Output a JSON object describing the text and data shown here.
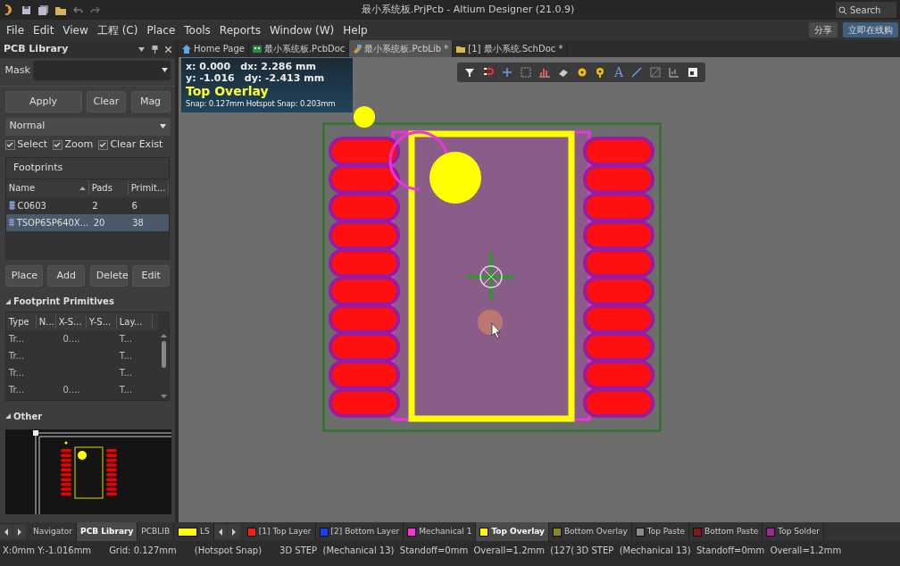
{
  "title_bar": {
    "title": "最小系统板.PrjPcb - Altium Designer (21.0.9)",
    "search": {
      "placeholder": "Search"
    }
  },
  "menu": [
    "File",
    "Edit",
    "View",
    "工程 (C)",
    "Place",
    "Tools",
    "Reports",
    "Window (W)",
    "Help"
  ],
  "top_buttons": [
    {
      "label": "分享",
      "kind": "share"
    },
    {
      "label": "立即在线购",
      "kind": "buy"
    }
  ],
  "panel": {
    "title": "PCB Library",
    "mask": {
      "label": "Mask"
    },
    "buttons": [
      "Apply",
      "Clear",
      "Mag"
    ],
    "mode": "Normal",
    "checks": [
      {
        "label": "Select",
        "checked": true
      },
      {
        "label": "Zoom",
        "checked": true
      },
      {
        "label": "Clear Exist",
        "checked": true
      }
    ],
    "footprints": {
      "title": "Footprints",
      "columns": [
        "Name",
        "Pads",
        "Primit..."
      ],
      "rows": [
        {
          "cells": [
            "C0603",
            "2",
            "6"
          ],
          "selected": false
        },
        {
          "cells": [
            "TSOP65P640X...",
            "20",
            "38"
          ],
          "selected": true
        }
      ]
    },
    "actions": [
      "Place",
      "Add",
      "Delete",
      "Edit"
    ],
    "primitives": {
      "title": "Footprint Primitives",
      "columns": [
        "Type",
        "N...",
        "X-S...",
        "Y-S...",
        "Lay..."
      ],
      "rows": [
        {
          "type": "Tr...",
          "x_size": "0....",
          "layer": "T..."
        },
        {
          "type": "Tr...",
          "layer": "T..."
        },
        {
          "type": "Tr...",
          "layer": "T..."
        },
        {
          "type": "Tr...",
          "x_size": "0....",
          "layer": "T..."
        }
      ]
    },
    "other": {
      "title": "Other"
    }
  },
  "tabs": [
    {
      "label": "Home Page",
      "kind": "home",
      "selected": false
    },
    {
      "label": "最小系统板.PcbDoc",
      "kind": "pcb",
      "selected": false
    },
    {
      "label": "最小系统板.PcbLib *",
      "kind": "lib",
      "selected": true
    },
    {
      "label": "[1] 最小系统.SchDoc *",
      "kind": "sch",
      "selected": false
    }
  ],
  "hud": {
    "x": "x:  0.000",
    "dx": "dx:  2.286 mm",
    "y": "y: -1.016",
    "dy": "dy: -2.413 mm",
    "layer": "Top Overlay",
    "snap": "Snap: 0.127mm Hotspot Snap: 0.203mm"
  },
  "toolbar": {
    "text_tool": "A"
  },
  "panel_tabs": [
    {
      "label": "Navigator",
      "selected": false
    },
    {
      "label": "PCB Library",
      "selected": true
    },
    {
      "label": "PCBLIB",
      "selected": false
    }
  ],
  "current_layer": "LS",
  "layers": [
    {
      "label": "[1] Top Layer",
      "color": "#ff1a1a",
      "selected": false
    },
    {
      "label": "[2] Bottom Layer",
      "color": "#1a3cff",
      "selected": false
    },
    {
      "label": "Mechanical 1",
      "color": "#ff33dd",
      "selected": false
    },
    {
      "label": "Top Overlay",
      "color": "#ffff00",
      "selected": true
    },
    {
      "label": "Bottom Overlay",
      "color": "#8a8a1a",
      "selected": false
    },
    {
      "label": "Top Paste",
      "color": "#8c8c8c",
      "selected": false
    },
    {
      "label": "Bottom Paste",
      "color": "#801a1a",
      "selected": false
    },
    {
      "label": "Top Solder",
      "color": "#9c2a9c",
      "selected": false
    }
  ],
  "status_bar": [
    "X:0mm Y:-1.016mm",
    "Grid: 0.127mm",
    "(Hotspot Snap)",
    "3D STEP  (Mechanical 13)  Standoff=0mm  Overall=1.2mm  (127(",
    "3D STEP  (Mechanical 13)  Standoff=0mm  Overall=1.2mm"
  ]
}
